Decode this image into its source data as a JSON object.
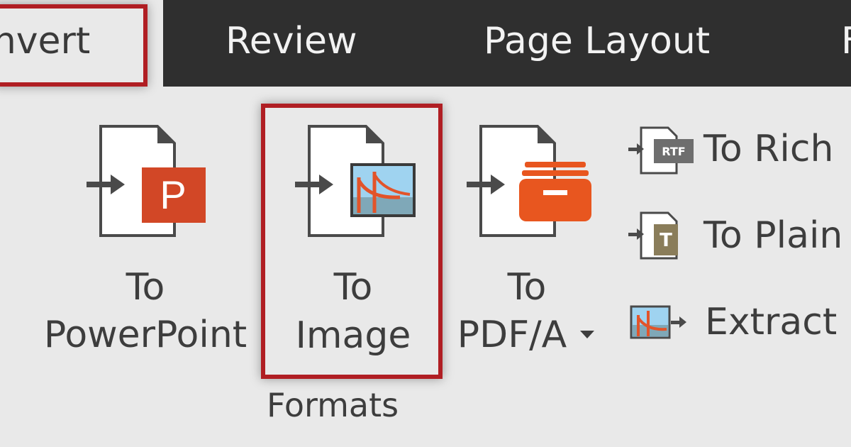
{
  "tabs": {
    "convert": "onvert",
    "review": "Review",
    "page_layout": "Page Layout",
    "partial": "F"
  },
  "ribbon": {
    "group_label": "Formats",
    "to_powerpoint": {
      "line1": "To",
      "line2": "PowerPoint"
    },
    "to_image": {
      "line1": "To",
      "line2": "Image"
    },
    "to_pdfa": {
      "line1": "To",
      "line2": "PDF/A"
    },
    "to_rich_text": "To Rich",
    "to_plain_text": "To Plain",
    "extract": "Extract",
    "rtf_badge": "RTF",
    "txt_badge": "T",
    "ppt_badge": "P"
  },
  "colors": {
    "tab_bar": "#2f2f2f",
    "ribbon_bg": "#e9e9e9",
    "highlight_red": "#b01e23",
    "powerpoint_red": "#d24726",
    "pdfa_orange": "#e8561f"
  },
  "icons": [
    "to-powerpoint-icon",
    "to-image-icon",
    "to-pdfa-icon",
    "to-rich-text-icon",
    "to-plain-text-icon",
    "extract-images-icon",
    "dropdown-arrow-icon"
  ]
}
